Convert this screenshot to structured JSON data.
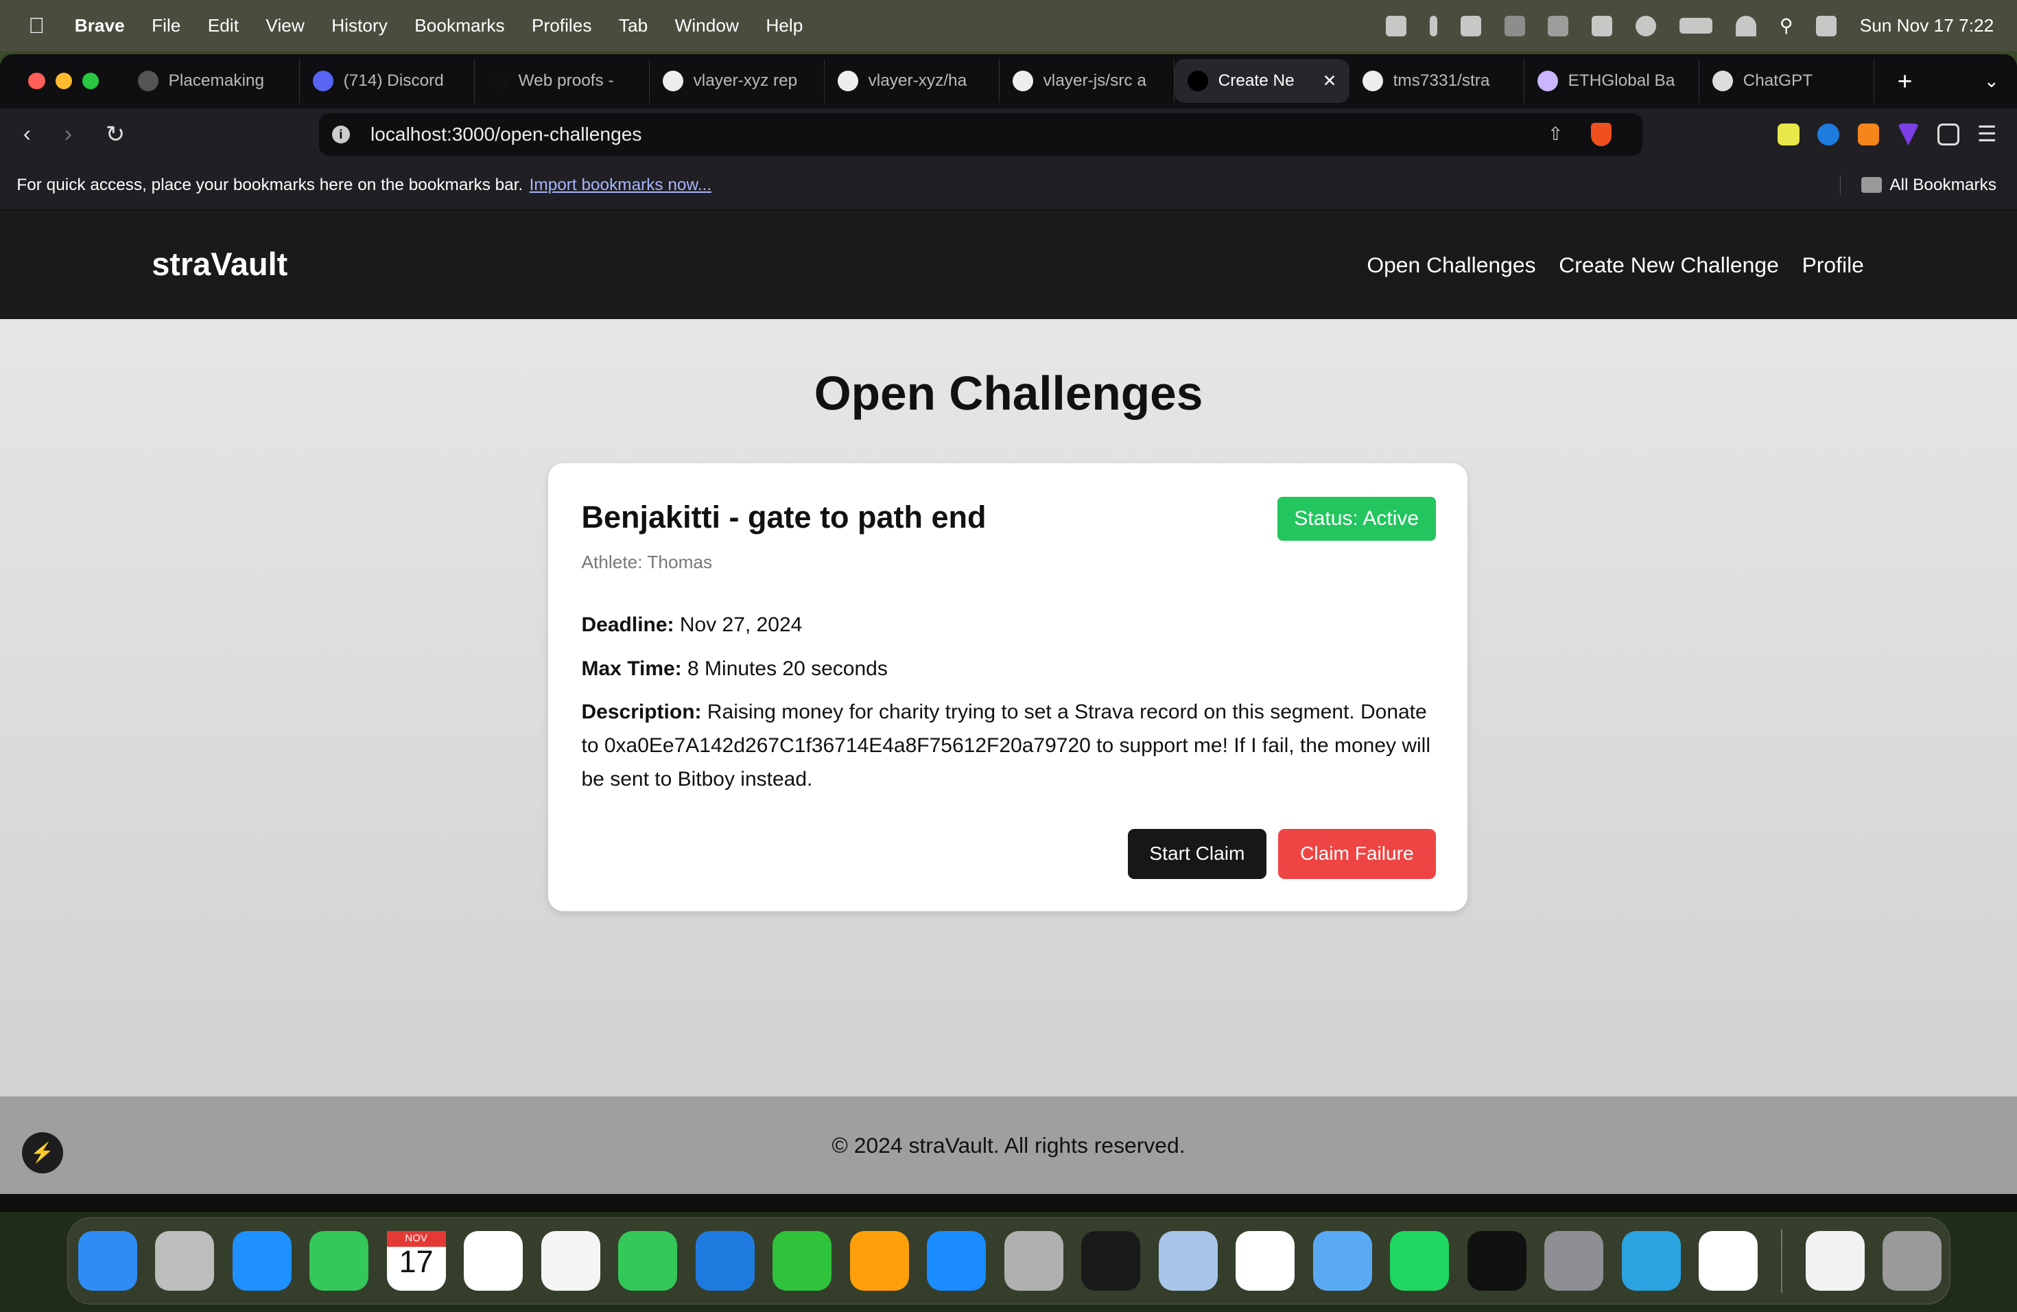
{
  "menubar": {
    "app": "Brave",
    "items": [
      "File",
      "Edit",
      "View",
      "History",
      "Bookmarks",
      "Profiles",
      "Tab",
      "Window",
      "Help"
    ],
    "clock": "Sun Nov 17  7:22"
  },
  "tabs": [
    {
      "label": "Placemaking",
      "active": false,
      "color": "#555"
    },
    {
      "label": "(714) Discord",
      "active": false,
      "color": "#5865f2"
    },
    {
      "label": "Web proofs -",
      "active": false,
      "color": "#111"
    },
    {
      "label": "vlayer-xyz rep",
      "active": false,
      "color": "#eee"
    },
    {
      "label": "vlayer-xyz/ha",
      "active": false,
      "color": "#eee"
    },
    {
      "label": "vlayer-js/src a",
      "active": false,
      "color": "#eee"
    },
    {
      "label": "Create Ne",
      "active": true,
      "color": "#000"
    },
    {
      "label": "tms7331/stra",
      "active": false,
      "color": "#eee"
    },
    {
      "label": "ETHGlobal Ba",
      "active": false,
      "color": "#c9b6ff"
    },
    {
      "label": "ChatGPT",
      "active": false,
      "color": "#ddd"
    }
  ],
  "address": {
    "url": "localhost:3000/open-challenges"
  },
  "bookmarks": {
    "hint": "For quick access, place your bookmarks here on the bookmarks bar.",
    "import_link": "Import bookmarks now...",
    "all": "All Bookmarks"
  },
  "site": {
    "logo": "straVault",
    "nav": [
      "Open Challenges",
      "Create New Challenge",
      "Profile"
    ],
    "page_title": "Open Challenges",
    "challenge": {
      "title": "Benjakitti - gate to path end",
      "status": "Status: Active",
      "athlete": "Athlete: Thomas",
      "deadline_label": "Deadline:",
      "deadline": "Nov 27, 2024",
      "maxtime_label": "Max Time:",
      "maxtime": "8 Minutes 20 seconds",
      "description_label": "Description:",
      "description": "Raising money for charity trying to set a Strava record on this segment. Donate to 0xa0Ee7A142d267C1f36714E4a8F75612F20a79720 to support me! If I fail, the money will be sent to Bitboy instead.",
      "start_claim": "Start Claim",
      "claim_failure": "Claim Failure"
    },
    "footer": "© 2024 straVault. All rights reserved."
  },
  "colors": {
    "status_active": "#22c55e",
    "claim_failure": "#ef4444",
    "header_bg": "#1a1a1a"
  },
  "dock": [
    {
      "name": "finder",
      "color": "#2f8cf5"
    },
    {
      "name": "launchpad",
      "color": "#bdbdbd"
    },
    {
      "name": "mail",
      "color": "#1e90ff"
    },
    {
      "name": "facetime",
      "color": "#34c759"
    },
    {
      "name": "calendar",
      "color": "#ffffff",
      "month": "NOV",
      "day": "17"
    },
    {
      "name": "reminders",
      "color": "#ffffff"
    },
    {
      "name": "freeform",
      "color": "#f5f5f5"
    },
    {
      "name": "messages",
      "color": "#34c759"
    },
    {
      "name": "keynote",
      "color": "#1f7ae0"
    },
    {
      "name": "numbers",
      "color": "#2fc23b"
    },
    {
      "name": "pages",
      "color": "#ff9f0a"
    },
    {
      "name": "app-store",
      "color": "#1a8cff"
    },
    {
      "name": "iphone-mirroring",
      "color": "#b0b0b0"
    },
    {
      "name": "terminal",
      "color": "#1a1a1a"
    },
    {
      "name": "preview",
      "color": "#a8c4e8"
    },
    {
      "name": "slack",
      "color": "#ffffff"
    },
    {
      "name": "keychain",
      "color": "#5aa9f5"
    },
    {
      "name": "spotify",
      "color": "#1ed760"
    },
    {
      "name": "cursor",
      "color": "#111111"
    },
    {
      "name": "system-settings",
      "color": "#8e8e93"
    },
    {
      "name": "telegram",
      "color": "#2aa3e0"
    },
    {
      "name": "brave",
      "color": "#ffffff"
    }
  ]
}
